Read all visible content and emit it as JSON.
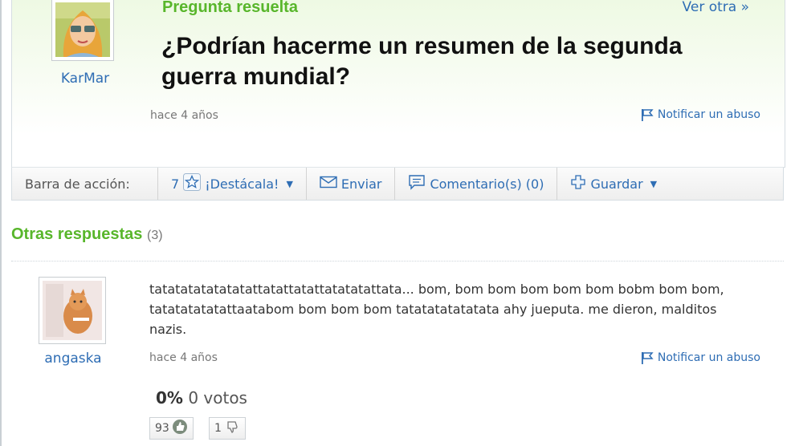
{
  "question": {
    "asker_name": "KarMar",
    "status_label": "Pregunta resuelta",
    "next_link": "Ver otra »",
    "title": "¿Podrían hacerme un resumen de la segunda guerra mundial?",
    "time": "hace 4 años",
    "report_label": "Notificar un abuso"
  },
  "action_bar": {
    "label": "Barra de acción:",
    "star_count": "7",
    "star_label": "¡Destácala!",
    "send_label": "Enviar",
    "comments_label": "Comentario(s) (0)",
    "save_label": "Guardar"
  },
  "other_answers": {
    "heading": "Otras respuestas",
    "count": "(3)",
    "items": [
      {
        "author": "angaska",
        "text": "tatatatatatatatattatattatattatatatattata... bom, bom bom bom bom bom bobm bom bom, tatatatatatattaatabom bom bom bom tatatatatatatata ahy jueputa. me dieron, malditos nazis.",
        "time": "hace 4 años",
        "report_label": "Notificar un abuso",
        "rating_percent": "0%",
        "rating_votes": "0 votos",
        "thumbs_up": "93",
        "thumbs_down": "1"
      }
    ]
  },
  "colors": {
    "green_heading": "#58b62b",
    "link_blue": "#2e6db4"
  }
}
